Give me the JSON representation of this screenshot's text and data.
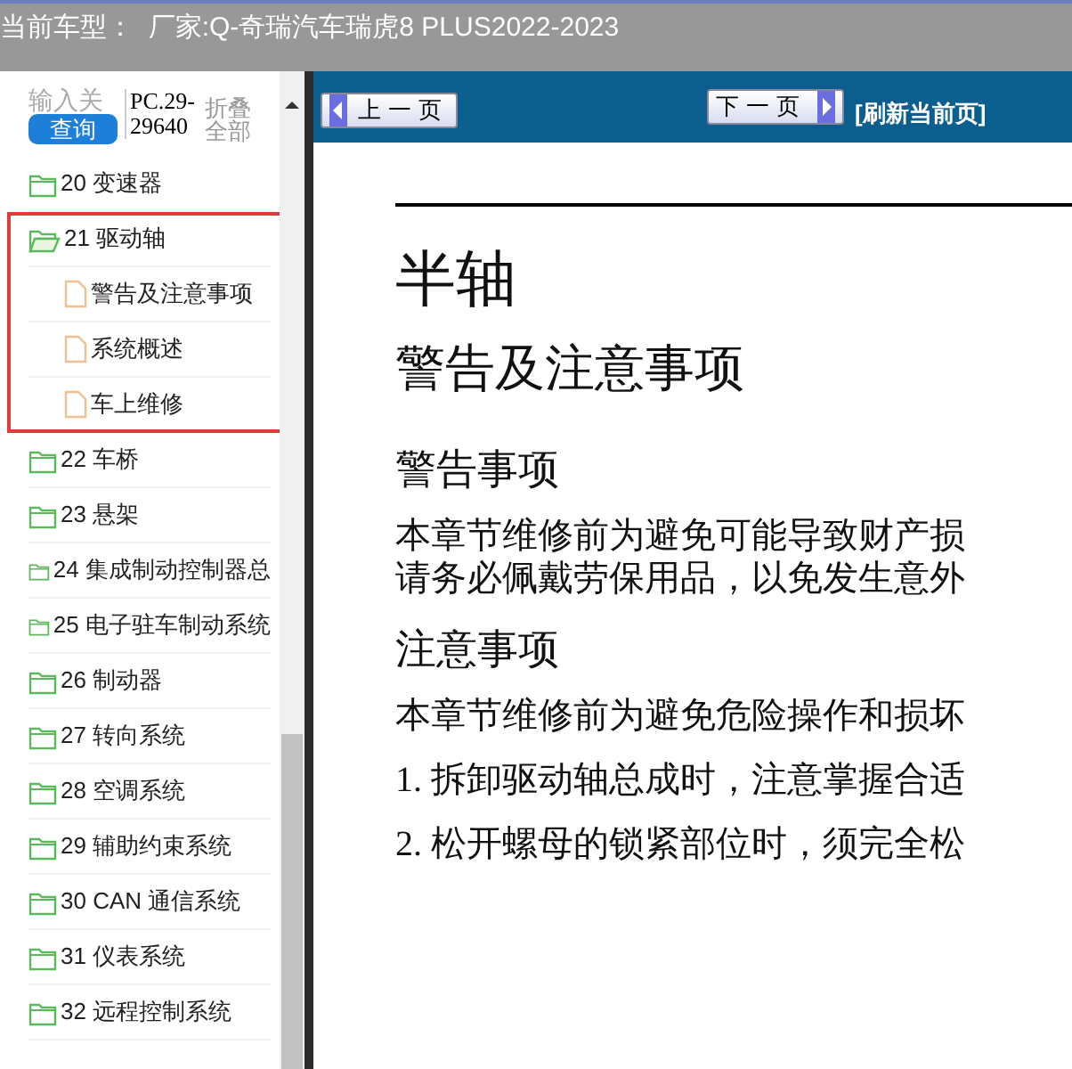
{
  "header": {
    "title": "当前车型：  厂家:Q-奇瑞汽车瑞虎8 PLUS2022-2023"
  },
  "sidebar": {
    "search": {
      "placeholder": "输入关"
    },
    "search_button": "查询",
    "code": "PC.29-29640",
    "collapse_all": "折叠全部",
    "tree": [
      {
        "label": "20 变速器",
        "expanded": false,
        "highlighted": false
      },
      {
        "label": "21 驱动轴",
        "expanded": true,
        "highlighted": true,
        "children": [
          {
            "label": "警告及注意事项"
          },
          {
            "label": "系统概述"
          },
          {
            "label": "车上维修"
          }
        ]
      },
      {
        "label": "22 车桥",
        "expanded": false,
        "highlighted": false
      },
      {
        "label": "23 悬架",
        "expanded": false,
        "highlighted": false
      },
      {
        "label": "24 集成制动控制器总",
        "expanded": false,
        "highlighted": false
      },
      {
        "label": "25 电子驻车制动系统",
        "expanded": false,
        "highlighted": false
      },
      {
        "label": "26 制动器",
        "expanded": false,
        "highlighted": false
      },
      {
        "label": "27 转向系统",
        "expanded": false,
        "highlighted": false
      },
      {
        "label": "28 空调系统",
        "expanded": false,
        "highlighted": false
      },
      {
        "label": "29 辅助约束系统",
        "expanded": false,
        "highlighted": false
      },
      {
        "label": "30 CAN 通信系统",
        "expanded": false,
        "highlighted": false
      },
      {
        "label": "31 仪表系统",
        "expanded": false,
        "highlighted": false
      },
      {
        "label": "32 远程控制系统",
        "expanded": false,
        "highlighted": false
      }
    ]
  },
  "toolbar": {
    "prev": "上一页",
    "next": "下一页",
    "refresh": "[刷新当前页]"
  },
  "document": {
    "blocks": [
      {
        "kind": "title",
        "text": "半轴"
      },
      {
        "kind": "subtitle",
        "text": "警告及注意事项"
      },
      {
        "kind": "heading",
        "text": "警告事项"
      },
      {
        "kind": "paragraph",
        "lines": [
          "本章节维修前为避免可能导致财产损",
          "请务必佩戴劳保用品，以免发生意外"
        ]
      },
      {
        "kind": "heading",
        "text": "注意事项"
      },
      {
        "kind": "paragraph",
        "lines": [
          "本章节维修前为避免危险操作和损坏"
        ]
      },
      {
        "kind": "paragraph",
        "lines": [
          "1. 拆卸驱动轴总成时，注意掌握合适"
        ]
      },
      {
        "kind": "paragraph",
        "lines": [
          "2. 松开螺母的锁紧部位时，须完全松"
        ]
      }
    ]
  }
}
